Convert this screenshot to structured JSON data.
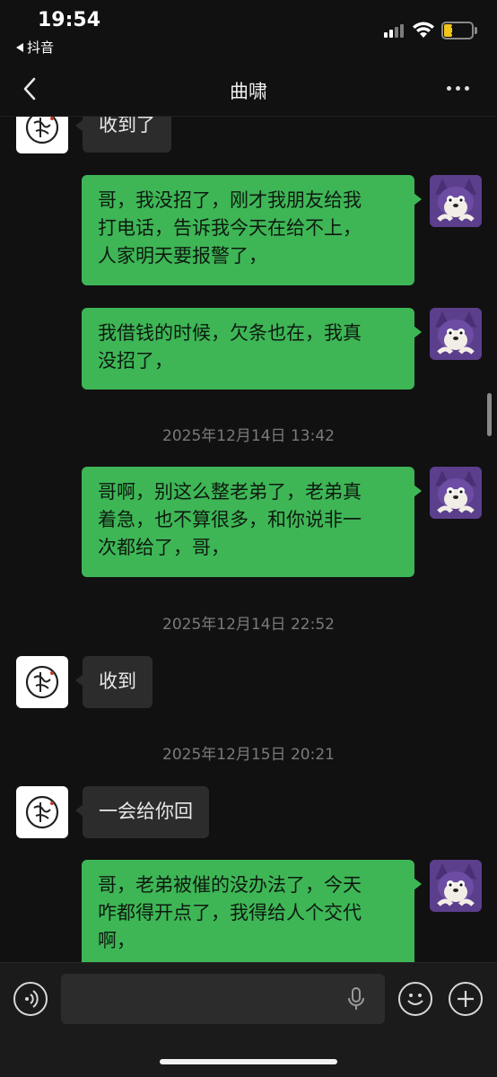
{
  "status_bar": {
    "time": "19:54",
    "back_app_label": "抖音",
    "battery_level": "17",
    "icons": [
      "signal-icon",
      "wifi-icon",
      "battery-icon"
    ]
  },
  "nav": {
    "title": "曲啸",
    "icons": [
      "back-chevron-icon",
      "more-options-icon"
    ]
  },
  "messages": [
    {
      "side": "left",
      "text": "收到了"
    },
    {
      "side": "right",
      "text": "哥，我没招了，刚才我朋友给我打电话，告诉我今天在给不上，人家明天要报警了，",
      "lines": [
        "哥，我没招了，刚才我朋友给我",
        "打电话，告诉我今天在给不上，",
        "人家明天要报警了，"
      ]
    },
    {
      "side": "right",
      "text": "我借钱的时候，欠条也在，我真没招了，",
      "lines": [
        "我借钱的时候，欠条也在，我真",
        "没招了，"
      ]
    },
    {
      "type": "timestamp",
      "text": "2025年12月14日 13:42"
    },
    {
      "side": "right",
      "text": "哥啊，别这么整老弟了，老弟真着急，也不算很多，和你说非一次都给了，哥，",
      "lines": [
        "哥啊，别这么整老弟了，老弟真",
        "着急，也不算很多，和你说非一",
        "次都给了，哥，"
      ]
    },
    {
      "type": "timestamp",
      "text": "2025年12月14日 22:52"
    },
    {
      "side": "left",
      "text": "收到"
    },
    {
      "type": "timestamp",
      "text": "2025年12月15日 20:21"
    },
    {
      "side": "left",
      "text": "一会给你回"
    },
    {
      "side": "right",
      "text": "哥，老弟被催的没办法了，今天咋都得开点了，我得给人个交代啊，",
      "lines": [
        "哥，老弟被催的没办法了，今天",
        "咋都得开点了，我得给人个交代",
        "啊，"
      ]
    }
  ],
  "input_bar": {
    "icons": [
      "voice-icon",
      "microphone-icon",
      "emoji-icon",
      "plus-icon"
    ],
    "placeholder": ""
  },
  "colors": {
    "background": "#111111",
    "bubble_right": "#3eb656",
    "bubble_left": "#2c2c2c",
    "timestamp": "#7a7a7a"
  }
}
